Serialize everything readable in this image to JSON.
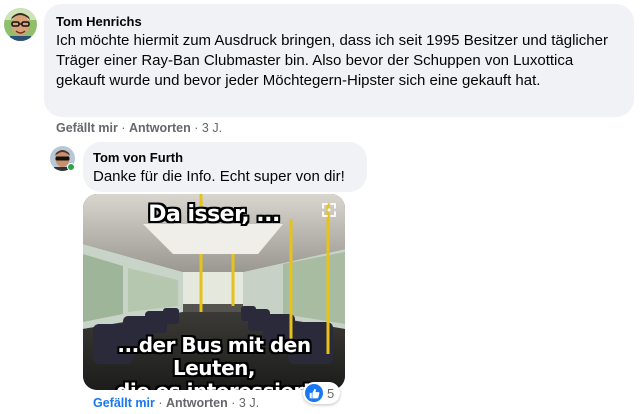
{
  "comment1": {
    "author": "Tom Henrichs",
    "text": "Ich möchte hiermit zum Ausdruck bringen, dass ich seit 1995 Besitzer und täglicher Träger einer Ray-Ban Clubmaster bin. Also bevor der Schuppen von Luxottica gekauft wurde und bevor jeder Möchtegern-Hipster sich eine gekauft hat.",
    "like_label": "Gefällt mir",
    "reply_label": "Antworten",
    "time": "3 J."
  },
  "comment2": {
    "author": "Tom von Furth",
    "text": "Danke für die Info. Echt super von dir!",
    "meme_top": "Da isser, ...",
    "meme_bottom_line1": "...der Bus mit den Leuten,",
    "meme_bottom_line2": "die es interessiert",
    "like_label": "Gefällt mir",
    "reply_label": "Antworten",
    "time": "3 J.",
    "reaction_count": "5",
    "reaction_icon": "thumbs-up-icon"
  },
  "separator": "·",
  "colors": {
    "bubble": "#f0f2f5",
    "link_blue": "#1877f2",
    "secondary_text": "#65676b",
    "online": "#31a24c"
  }
}
